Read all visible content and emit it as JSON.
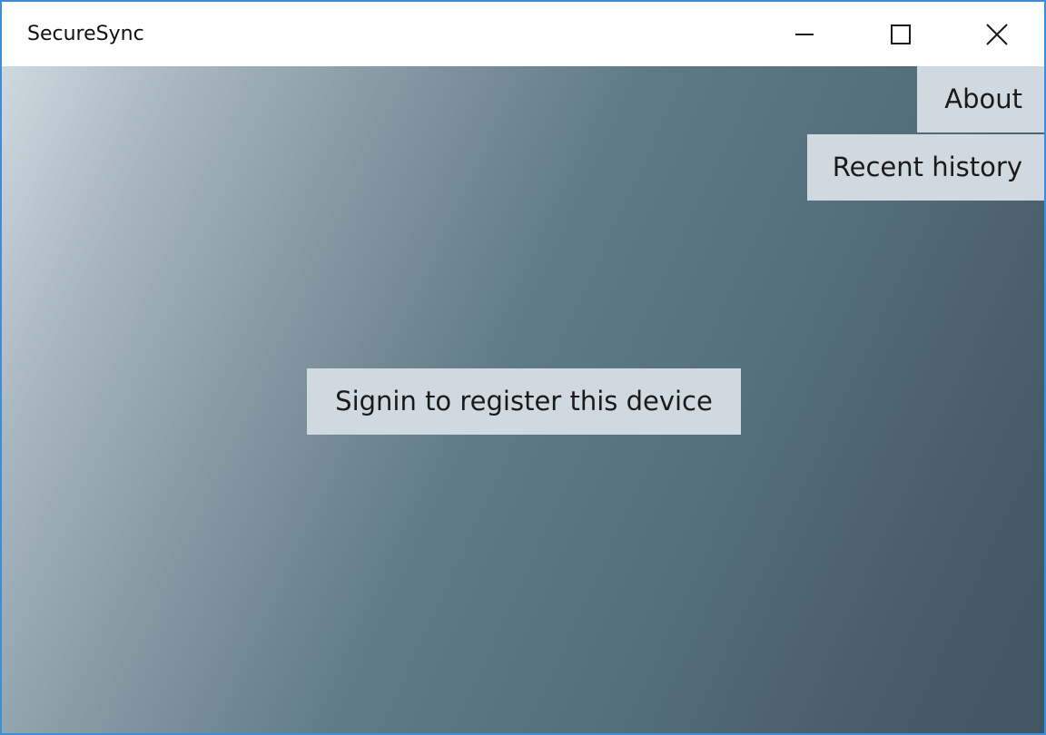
{
  "window": {
    "title": "SecureSync",
    "accent_border_color": "#3c8fd6",
    "controls": {
      "minimize_icon": "minimize-icon",
      "maximize_icon": "maximize-icon",
      "close_icon": "close-icon"
    }
  },
  "menu": {
    "about_label": "About",
    "recent_history_label": "Recent history"
  },
  "main": {
    "signin_label": "Signin to register this device"
  },
  "colors": {
    "button_background": "#d0d9df",
    "gradient_light": "#cfd8df",
    "gradient_dark": "#415560"
  }
}
